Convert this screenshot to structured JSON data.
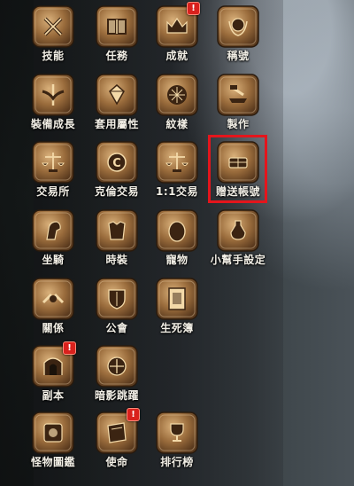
{
  "menu": {
    "rows": [
      [
        {
          "id": "skills",
          "label": "技能",
          "icon": "crossed-swords-icon",
          "badge": null
        },
        {
          "id": "quests",
          "label": "任務",
          "icon": "book-icon",
          "badge": null
        },
        {
          "id": "achievements",
          "label": "成就",
          "icon": "crown-icon",
          "badge": "!"
        },
        {
          "id": "titles",
          "label": "稱號",
          "icon": "laurel-emblem-icon",
          "badge": null
        }
      ],
      [
        {
          "id": "equip-growth",
          "label": "裝備成長",
          "icon": "winged-sword-icon",
          "badge": null
        },
        {
          "id": "set-attributes",
          "label": "套用屬性",
          "icon": "gem-icon",
          "badge": null
        },
        {
          "id": "patterns",
          "label": "紋樣",
          "icon": "pattern-disc-icon",
          "badge": null
        },
        {
          "id": "crafting",
          "label": "製作",
          "icon": "anvil-hammer-icon",
          "badge": null
        }
      ],
      [
        {
          "id": "exchange",
          "label": "交易所",
          "icon": "scales-icon",
          "badge": null
        },
        {
          "id": "diamond-trade",
          "label": "克倫交易",
          "icon": "coin-c-icon",
          "badge": null
        },
        {
          "id": "one-on-one-trade",
          "label": "1:1交易",
          "icon": "balance-icon",
          "badge": null
        },
        {
          "id": "gift-account",
          "label": "贈送帳號",
          "icon": "gift-hands-icon",
          "badge": null
        }
      ],
      [
        {
          "id": "mount",
          "label": "坐騎",
          "icon": "horse-head-icon",
          "badge": null
        },
        {
          "id": "fashion",
          "label": "時裝",
          "icon": "armor-icon",
          "badge": null
        },
        {
          "id": "pets",
          "label": "寵物",
          "icon": "egg-icon",
          "badge": null
        },
        {
          "id": "helper-settings",
          "label": "小幫手設定",
          "icon": "potion-crest-icon",
          "badge": null
        }
      ],
      [
        {
          "id": "relations",
          "label": "關係",
          "icon": "handshake-icon",
          "badge": null
        },
        {
          "id": "guild",
          "label": "公會",
          "icon": "shield-banner-icon",
          "badge": null
        },
        {
          "id": "life-death-book",
          "label": "生死簿",
          "icon": "ledger-icon",
          "badge": null
        }
      ],
      [
        {
          "id": "dungeon",
          "label": "副本",
          "icon": "gate-icon",
          "badge": "!"
        },
        {
          "id": "shadow-dungeon",
          "label": "暗影跳躍",
          "icon": "compass-gate-icon",
          "badge": null
        }
      ],
      [
        {
          "id": "codex",
          "label": "怪物圖鑑",
          "icon": "monster-book-icon",
          "badge": null
        },
        {
          "id": "mission",
          "label": "使命",
          "icon": "tome-icon",
          "badge": "!"
        },
        {
          "id": "ranking",
          "label": "排行榜",
          "icon": "trophy-icon",
          "badge": null
        }
      ]
    ]
  },
  "colors": {
    "label": "#f2efe6",
    "badge": "#d9211d",
    "highlight": "#e4151c",
    "bronze_light": "#d9b07a",
    "bronze_dark": "#5a3a1e"
  }
}
